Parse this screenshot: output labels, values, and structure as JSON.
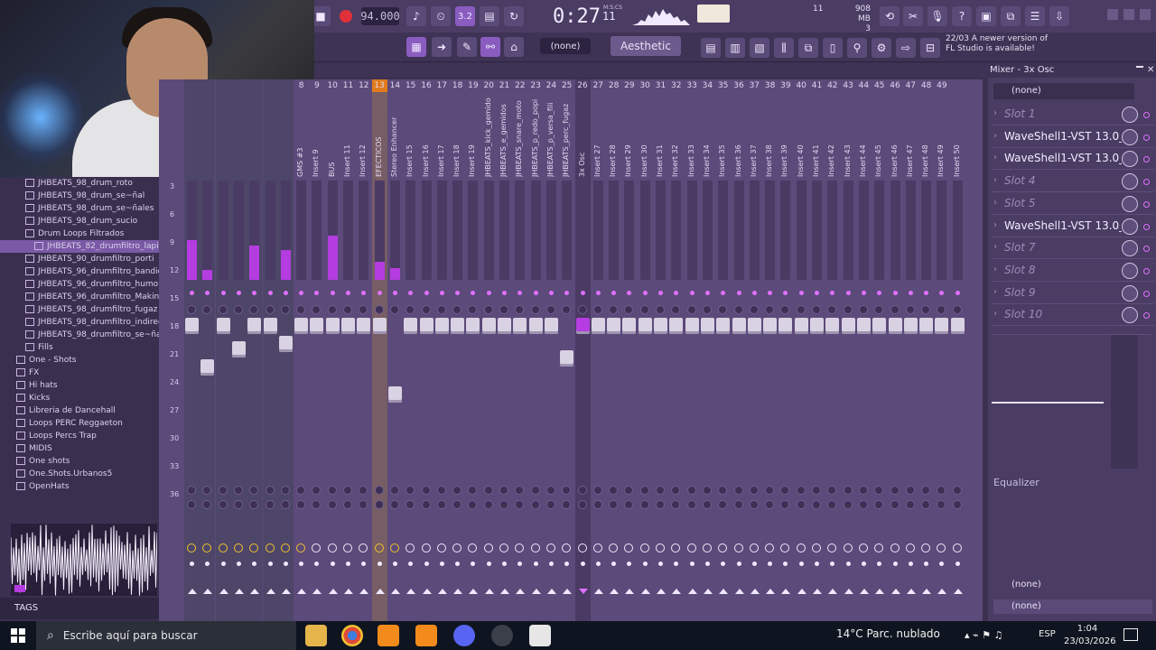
{
  "transport": {
    "tempo": "94.000",
    "time": "0:27",
    "time_sub": "11",
    "time_unit": "M:S:CS",
    "cpu": "11",
    "memory": "908 MB",
    "polyphony": "3",
    "pattern_num": "3.2"
  },
  "toolbar": {
    "preset": "(none)",
    "style_name": "Aesthetic",
    "news_line1": "22/03  A newer version of",
    "news_line2": "FL Studio is available!"
  },
  "browser": {
    "items": [
      {
        "label": "JHBEATS_98_drum_roto",
        "indent": 2,
        "type": "file"
      },
      {
        "label": "JHBEATS_98_drum_se~ñal",
        "indent": 2,
        "type": "file"
      },
      {
        "label": "JHBEATS_98_drum_se~ñales",
        "indent": 2,
        "type": "file"
      },
      {
        "label": "JHBEATS_98_drum_sucio",
        "indent": 2,
        "type": "file"
      },
      {
        "label": "Drum Loops Filtrados",
        "indent": 2,
        "type": "folder"
      },
      {
        "label": "JHBEATS_82_drumfiltro_lapieza",
        "indent": 3,
        "type": "file",
        "selected": true
      },
      {
        "label": "JHBEATS_90_drumfiltro_porti",
        "indent": 2,
        "type": "file"
      },
      {
        "label": "JHBEATS_96_drumfiltro_bandida",
        "indent": 2,
        "type": "file"
      },
      {
        "label": "JHBEATS_96_drumfiltro_humo",
        "indent": 2,
        "type": "file"
      },
      {
        "label": "JHBEATS_96_drumfiltro_Makinon",
        "indent": 2,
        "type": "file"
      },
      {
        "label": "JHBEATS_98_drumfiltro_fugaz",
        "indent": 2,
        "type": "file"
      },
      {
        "label": "JHBEATS_98_drumfiltro_indirecta",
        "indent": 2,
        "type": "file"
      },
      {
        "label": "JHBEATS_98_drumfiltro_se~ñales",
        "indent": 2,
        "type": "file"
      },
      {
        "label": "Fills",
        "indent": 2,
        "type": "folder"
      },
      {
        "label": "One - Shots",
        "indent": 1,
        "type": "folder"
      },
      {
        "label": "FX",
        "indent": 1,
        "type": "folder"
      },
      {
        "label": "Hi hats",
        "indent": 1,
        "type": "folder"
      },
      {
        "label": "Kicks",
        "indent": 1,
        "type": "folder"
      },
      {
        "label": "Libreria de Dancehall",
        "indent": 1,
        "type": "folder"
      },
      {
        "label": "Loops PERC Reggaeton",
        "indent": 1,
        "type": "folder"
      },
      {
        "label": "Loops Percs Trap",
        "indent": 1,
        "type": "folder"
      },
      {
        "label": "MIDIS",
        "indent": 1,
        "type": "folder"
      },
      {
        "label": "One shots",
        "indent": 1,
        "type": "folder"
      },
      {
        "label": "One.Shots.Urbanos5",
        "indent": 1,
        "type": "folder"
      },
      {
        "label": "OpenHats",
        "indent": 1,
        "type": "folder"
      }
    ],
    "tags_label": "TAGS"
  },
  "mixer": {
    "title": "Mixer - 3x Osc",
    "scale": [
      "3",
      "6",
      "9",
      "12",
      "15",
      "18",
      "21",
      "24",
      "27",
      "30",
      "33",
      "36"
    ],
    "tracks": [
      {
        "num": "",
        "name": "",
        "level": 0.4,
        "fader": 0.32
      },
      {
        "num": "",
        "name": "",
        "level": 0.1,
        "fader": 0.55
      },
      {
        "num": "",
        "name": "",
        "level": 0.0,
        "fader": 0.32
      },
      {
        "num": "",
        "name": "",
        "level": 0.0,
        "fader": 0.45
      },
      {
        "num": "",
        "name": "",
        "level": 0.35,
        "fader": 0.32
      },
      {
        "num": "",
        "name": "",
        "level": 0.0,
        "fader": 0.32
      },
      {
        "num": "",
        "name": "",
        "level": 0.3,
        "fader": 0.42
      },
      {
        "num": "8",
        "name": "GMS #3",
        "level": 0.0,
        "fader": 0.32
      },
      {
        "num": "9",
        "name": "Insert 9",
        "level": 0.0,
        "fader": 0.32
      },
      {
        "num": "10",
        "name": "BUS",
        "level": 0.45,
        "fader": 0.32
      },
      {
        "num": "11",
        "name": "Insert 11",
        "level": 0.0,
        "fader": 0.32
      },
      {
        "num": "12",
        "name": "Insert 12",
        "level": 0.0,
        "fader": 0.32
      },
      {
        "num": "13",
        "name": "EFECTICOS",
        "level": 0.18,
        "fader": 0.32
      },
      {
        "num": "14",
        "name": "Stereo Enhancer",
        "level": 0.12,
        "fader": 0.7
      },
      {
        "num": "15",
        "name": "Insert 15",
        "level": 0.0,
        "fader": 0.32
      },
      {
        "num": "16",
        "name": "Insert 16",
        "level": 0.0,
        "fader": 0.32
      },
      {
        "num": "17",
        "name": "Insert 17",
        "level": 0.0,
        "fader": 0.32
      },
      {
        "num": "18",
        "name": "Insert 18",
        "level": 0.0,
        "fader": 0.32
      },
      {
        "num": "19",
        "name": "Insert 19",
        "level": 0.0,
        "fader": 0.32
      },
      {
        "num": "20",
        "name": "JHBEATS_kick_gemido",
        "level": 0.0,
        "fader": 0.32
      },
      {
        "num": "21",
        "name": "JHBEATS_e_gemidos",
        "level": 0.0,
        "fader": 0.32
      },
      {
        "num": "22",
        "name": "JHBEATS_snare_moto",
        "level": 0.0,
        "fader": 0.32
      },
      {
        "num": "23",
        "name": "JHBEATS_p_redo_popi",
        "level": 0.0,
        "fader": 0.32
      },
      {
        "num": "24",
        "name": "JHBEATS_p_versa_fili",
        "level": 0.0,
        "fader": 0.32
      },
      {
        "num": "25",
        "name": "JHBEATS_perc_fugaz",
        "level": 0.0,
        "fader": 0.5
      },
      {
        "num": "26",
        "name": "3x Osc",
        "level": 0.0,
        "fader": 0.32
      },
      {
        "num": "27",
        "name": "Insert 27",
        "level": 0.0,
        "fader": 0.32
      },
      {
        "num": "28",
        "name": "Insert 28",
        "level": 0.0,
        "fader": 0.32
      },
      {
        "num": "29",
        "name": "Insert 29",
        "level": 0.0,
        "fader": 0.32
      },
      {
        "num": "30",
        "name": "Insert 30",
        "level": 0.0,
        "fader": 0.32
      },
      {
        "num": "31",
        "name": "Insert 31",
        "level": 0.0,
        "fader": 0.32
      },
      {
        "num": "32",
        "name": "Insert 32",
        "level": 0.0,
        "fader": 0.32
      },
      {
        "num": "33",
        "name": "Insert 33",
        "level": 0.0,
        "fader": 0.32
      },
      {
        "num": "34",
        "name": "Insert 34",
        "level": 0.0,
        "fader": 0.32
      },
      {
        "num": "35",
        "name": "Insert 35",
        "level": 0.0,
        "fader": 0.32
      },
      {
        "num": "36",
        "name": "Insert 36",
        "level": 0.0,
        "fader": 0.32
      },
      {
        "num": "37",
        "name": "Insert 37",
        "level": 0.0,
        "fader": 0.32
      },
      {
        "num": "38",
        "name": "Insert 38",
        "level": 0.0,
        "fader": 0.32
      },
      {
        "num": "39",
        "name": "Insert 39",
        "level": 0.0,
        "fader": 0.32
      },
      {
        "num": "40",
        "name": "Insert 40",
        "level": 0.0,
        "fader": 0.32
      },
      {
        "num": "41",
        "name": "Insert 41",
        "level": 0.0,
        "fader": 0.32
      },
      {
        "num": "42",
        "name": "Insert 42",
        "level": 0.0,
        "fader": 0.32
      },
      {
        "num": "43",
        "name": "Insert 43",
        "level": 0.0,
        "fader": 0.32
      },
      {
        "num": "44",
        "name": "Insert 44",
        "level": 0.0,
        "fader": 0.32
      },
      {
        "num": "45",
        "name": "Insert 45",
        "level": 0.0,
        "fader": 0.32
      },
      {
        "num": "46",
        "name": "Insert 46",
        "level": 0.0,
        "fader": 0.32
      },
      {
        "num": "47",
        "name": "Insert 47",
        "level": 0.0,
        "fader": 0.32
      },
      {
        "num": "48",
        "name": "Insert 48",
        "level": 0.0,
        "fader": 0.32
      },
      {
        "num": "49",
        "name": "Insert 49",
        "level": 0.0,
        "fader": 0.32
      },
      {
        "num": "",
        "name": "Insert 50",
        "level": 0.0,
        "fader": 0.32
      }
    ],
    "channel_preset": "(none)",
    "slots": [
      {
        "label": "Slot 1",
        "filled": false
      },
      {
        "label": "WaveShell1-VST 13.0_x6...",
        "filled": true
      },
      {
        "label": "WaveShell1-VST 13.0_x6...",
        "filled": true
      },
      {
        "label": "Slot 4",
        "filled": false
      },
      {
        "label": "Slot 5",
        "filled": false
      },
      {
        "label": "WaveShell1-VST 13.0_x6...",
        "filled": true
      },
      {
        "label": "Slot 7",
        "filled": false
      },
      {
        "label": "Slot 8",
        "filled": false
      },
      {
        "label": "Slot 9",
        "filled": false
      },
      {
        "label": "Slot 10",
        "filled": false
      }
    ],
    "equalizer_label": "Equalizer",
    "input_none": "(none)",
    "output_none": "(none)"
  },
  "taskbar": {
    "search_placeholder": "Escribe aquí para buscar",
    "weather": "14°C  Parc. nublado",
    "lang": "ESP",
    "time": "1:04",
    "date": "23/03/2026"
  },
  "colors": {
    "accent": "#b43ce0",
    "panel": "#5c4a7a"
  }
}
